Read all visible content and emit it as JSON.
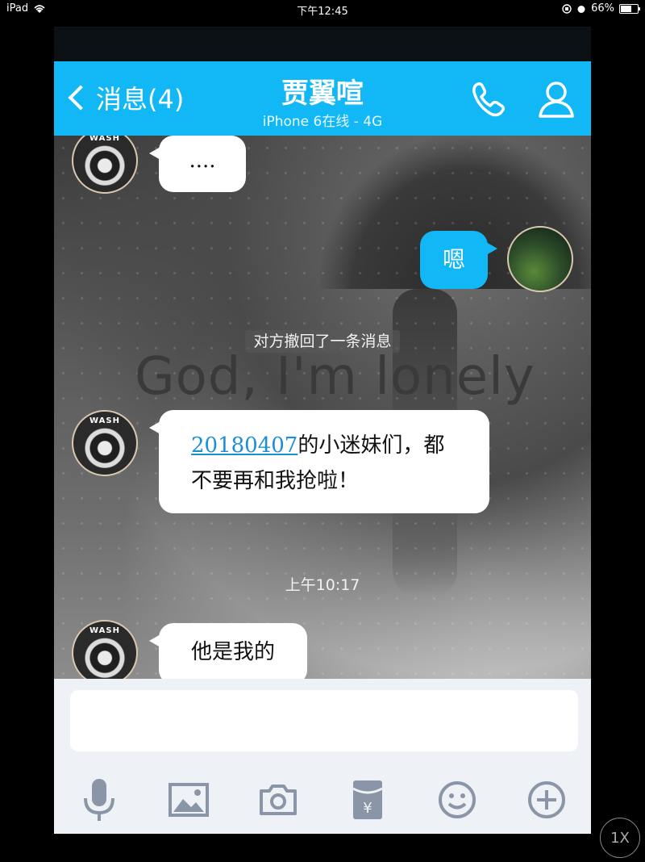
{
  "status_bar": {
    "device": "iPad",
    "time": "下午12:45",
    "battery": "66%"
  },
  "nav": {
    "back_label": "消息(4)",
    "contact_name": "贾翼喧",
    "contact_status": "iPhone 6在线 - 4G"
  },
  "chat": {
    "overlay_text": "God, I'm lonely",
    "messages": [
      {
        "side": "left",
        "avatar_label": "WASH",
        "text": "...."
      },
      {
        "side": "right",
        "text": "嗯"
      },
      {
        "type": "system",
        "text": "对方撤回了一条消息"
      },
      {
        "side": "left",
        "avatar_label": "WASH",
        "link_text": "20180407",
        "text_after_link": "的小迷妹们，都",
        "text_line2": "不要再和我抢啦！"
      },
      {
        "type": "timestamp",
        "text": "上午10:17"
      },
      {
        "side": "left",
        "avatar_label": "WASH",
        "text": "他是我的"
      }
    ]
  },
  "input": {
    "placeholder": ""
  },
  "speed_badge": "1X",
  "colors": {
    "accent": "#12b7f5",
    "link": "#1b8fd6"
  }
}
